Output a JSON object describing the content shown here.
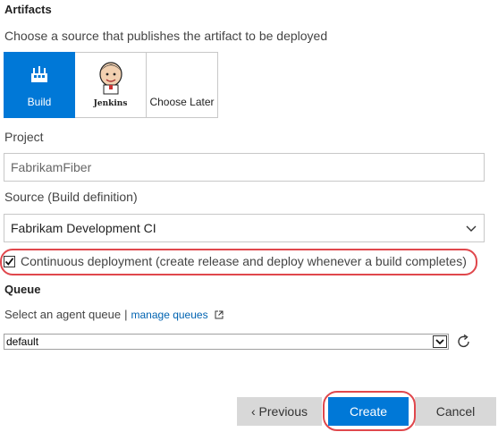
{
  "artifacts": {
    "title": "Artifacts",
    "subtitle": "Choose a source that publishes the artifact to be deployed",
    "sources": [
      {
        "label": "Build",
        "icon": "build-icon",
        "selected": true
      },
      {
        "label": "Jenkins",
        "icon": "jenkins-icon",
        "selected": false
      },
      {
        "label": "Choose Later",
        "icon": "",
        "selected": false
      }
    ]
  },
  "project": {
    "label": "Project",
    "value": "FabrikamFiber"
  },
  "source": {
    "label": "Source (Build definition)",
    "value": "Fabrikam Development CI"
  },
  "continuous_deployment": {
    "checked": true,
    "label": "Continuous deployment (create release and deploy whenever a build completes)"
  },
  "queue": {
    "title": "Queue",
    "prompt": "Select an agent queue",
    "separator": "|",
    "manage_link": "manage queues",
    "value": "default"
  },
  "buttons": {
    "previous": "‹ Previous",
    "create": "Create",
    "cancel": "Cancel"
  },
  "colors": {
    "accent": "#0078d7",
    "highlight": "#e0474c",
    "link": "#0063b1",
    "secondary_button": "#d8d8d8"
  }
}
